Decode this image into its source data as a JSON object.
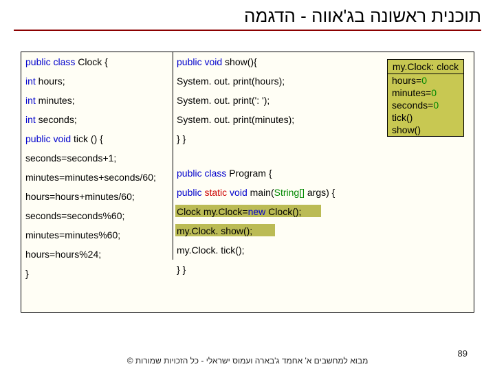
{
  "title": "תוכנית ראשונה בג'אווה - הדגמה",
  "col1": {
    "l0a": "public class ",
    "l0b": "  Clock  {",
    "l1a": "int",
    "l1b": " hours;",
    "l2a": "int",
    "l2b": " minutes;",
    "l3a": "int",
    "l3b": " seconds;",
    "l4a": "public void",
    "l4b": " tick () {",
    "l5": " seconds=seconds+1;",
    "l6": " minutes=minutes+seconds/60;",
    "l7": " hours=hours+minutes/60;",
    "l8": " seconds=seconds%60;",
    "l9": " minutes=minutes%60;",
    "l10": " hours=hours%24;",
    "l11": " }"
  },
  "col2": {
    "l0a": "public void",
    "l0b": " show(){",
    "l1": "System. out. print(hours);",
    "l2": "System. out. print(': ');",
    "l3": "System. out. print(minutes);",
    "l4": " } }",
    "l5a": "public class ",
    "l5b": "  Program  {",
    "l6a": "public ",
    "l6b": "static ",
    "l6c": "void",
    "l6d": " main(",
    "l6e": "String[] ",
    "l6f": "args) {",
    "l7a": " Clock ",
    "l7b": " my.Clock=",
    "l7c": "new",
    "l7d": " Clock();",
    "l8": " my.Clock. show();",
    "l9": " my.Clock. tick();",
    "l10": " } }"
  },
  "obj": {
    "header": "my.Clock: clock",
    "r1a": "hours=",
    "r1b": "0",
    "r2a": "minutes=",
    "r2b": "0",
    "r3a": "seconds=",
    "r3b": "0",
    "r4": "tick()",
    "r5": "show()"
  },
  "footer": "מבוא למחשבים א' אחמד ג'בארה ועמוס ישראלי - כל הזכויות שמורות ©",
  "page": "89"
}
